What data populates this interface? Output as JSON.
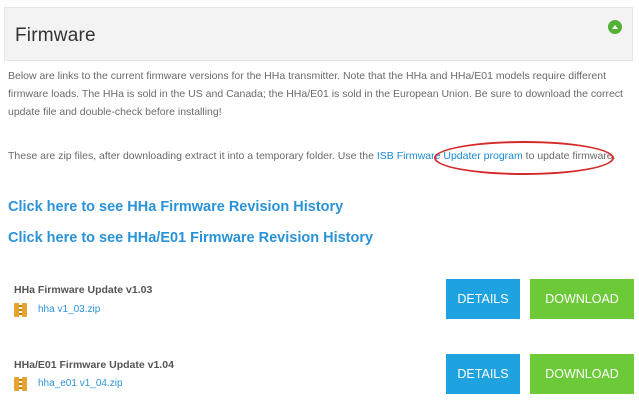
{
  "header": {
    "title": "Firmware"
  },
  "intro": {
    "text": "Below are links to the current firmware versions for the HHa transmitter. Note that the HHa and HHa/E01 models require different firmware loads. The HHa is sold in the US and Canada; the HHa/E01 is sold in the European Union. Be sure to download the correct update file and double-check before installing!"
  },
  "zip_note": {
    "before": "These are zip files, after downloading extract it into a temporary folder. Use the ",
    "link": "ISB Firmware Updater program",
    "after": " to update firmware."
  },
  "history_links": [
    "Click here to see HHa Firmware Revision History",
    "Click here to see HHa/E01 Firmware Revision History"
  ],
  "updates": [
    {
      "title": "HHa Firmware Update v1.03",
      "file": "hha v1_03.zip",
      "details": "DETAILS",
      "download": "DOWNLOAD"
    },
    {
      "title": "HHa/E01 Firmware Update v1.04",
      "file": "hha_e01 v1_04.zip",
      "details": "DETAILS",
      "download": "DOWNLOAD"
    }
  ],
  "colors": {
    "link": "#2a93d8",
    "details_button": "#1fa3e0",
    "download_button": "#6cc937",
    "annotation_circle": "#d42a2a"
  }
}
